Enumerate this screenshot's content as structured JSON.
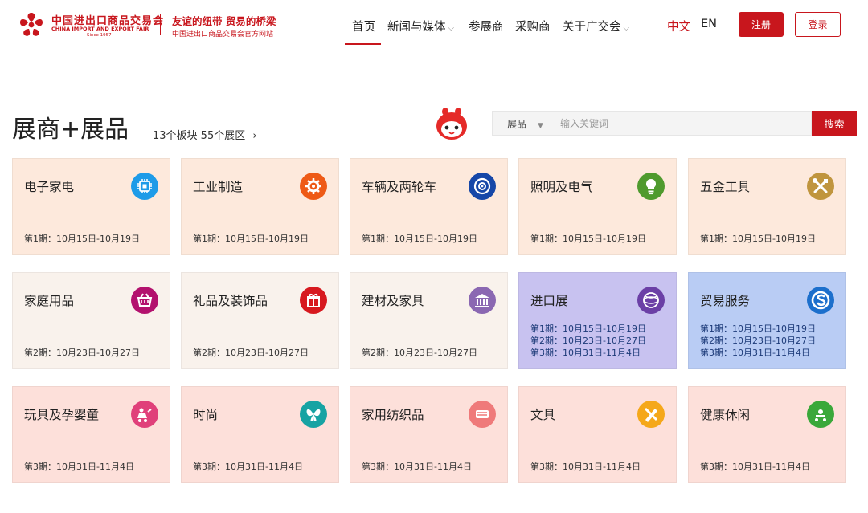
{
  "header": {
    "logo_cn": "中国进出口商品交易会",
    "logo_en": "CHINA IMPORT AND EXPORT FAIR",
    "logo_since": "Since 1957",
    "slogan": "友谊的纽带 贸易的桥梁",
    "slogan_sub": "中国进出口商品交易会官方网站",
    "nav": [
      {
        "label": "首页",
        "active": true
      },
      {
        "label": "新闻与媒体",
        "dropdown": true
      },
      {
        "label": "参展商"
      },
      {
        "label": "采购商"
      },
      {
        "label": "关于广交会",
        "dropdown": true
      }
    ],
    "lang_cn": "中文",
    "lang_en": "EN",
    "register_label": "注册",
    "login_label": "登录"
  },
  "section": {
    "title": "展商+展品",
    "summary_link": "13个板块 55个展区"
  },
  "search": {
    "select_value": "展品",
    "placeholder": "输入关键词",
    "button_label": "搜索"
  },
  "categories": [
    {
      "name": "电子家电",
      "icon": "chip-icon",
      "color": "#1e9be8",
      "bg": "#fde9dc",
      "dates": [
        "第1期：10月15日-10月19日"
      ]
    },
    {
      "name": "工业制造",
      "icon": "gear-icon",
      "color": "#ee5a16",
      "bg": "#fde9dc",
      "dates": [
        "第1期：10月15日-10月19日"
      ]
    },
    {
      "name": "车辆及两轮车",
      "icon": "wheel-icon",
      "color": "#1647a8",
      "bg": "#fde9dc",
      "dates": [
        "第1期：10月15日-10月19日"
      ]
    },
    {
      "name": "照明及电气",
      "icon": "bulb-icon",
      "color": "#4f9a2e",
      "bg": "#fde9dc",
      "dates": [
        "第1期：10月15日-10月19日"
      ]
    },
    {
      "name": "五金工具",
      "icon": "tools-icon",
      "color": "#c0953e",
      "bg": "#fde9dc",
      "dates": [
        "第1期：10月15日-10月19日"
      ]
    },
    {
      "name": "家庭用品",
      "icon": "basket-icon",
      "color": "#b3126e",
      "bg": "#f9f2ec",
      "dates": [
        "第2期：10月23日-10月27日"
      ]
    },
    {
      "name": "礼品及装饰品",
      "icon": "gift-icon",
      "color": "#d7191f",
      "bg": "#f9f2ec",
      "dates": [
        "第2期：10月23日-10月27日"
      ]
    },
    {
      "name": "建材及家具",
      "icon": "building-icon",
      "color": "#8b68b2",
      "bg": "#f9f2ec",
      "dates": [
        "第2期：10月23日-10月27日"
      ]
    },
    {
      "name": "进口展",
      "icon": "globe-icon",
      "color": "#6b3fa6",
      "bg": "#c8c2f0",
      "dates": [
        "第1期：10月15日-10月19日",
        "第2期：10月23日-10月27日",
        "第3期：10月31日-11月4日"
      ],
      "blue": true
    },
    {
      "name": "贸易服务",
      "icon": "service-icon",
      "color": "#1c6fcc",
      "bg": "#b9ccf4",
      "dates": [
        "第1期：10月15日-10月19日",
        "第2期：10月23日-10月27日",
        "第3期：10月31日-11月4日"
      ],
      "blue": true
    },
    {
      "name": "玩具及孕婴童",
      "icon": "toy-icon",
      "color": "#e0407a",
      "bg": "#fde0da",
      "dates": [
        "第3期：10月31日-11月4日"
      ]
    },
    {
      "name": "时尚",
      "icon": "butterfly-icon",
      "color": "#17a3a3",
      "bg": "#fde0da",
      "dates": [
        "第3期：10月31日-11月4日"
      ]
    },
    {
      "name": "家用纺织品",
      "icon": "textile-icon",
      "color": "#ef7a7a",
      "bg": "#fde0da",
      "dates": [
        "第3期：10月31日-11月4日"
      ]
    },
    {
      "name": "文具",
      "icon": "stationery-icon",
      "color": "#f5a81a",
      "bg": "#fde0da",
      "dates": [
        "第3期：10月31日-11月4日"
      ]
    },
    {
      "name": "健康休闲",
      "icon": "health-icon",
      "color": "#3aa83a",
      "bg": "#fde0da",
      "dates": [
        "第3期：10月31日-11月4日"
      ]
    }
  ]
}
